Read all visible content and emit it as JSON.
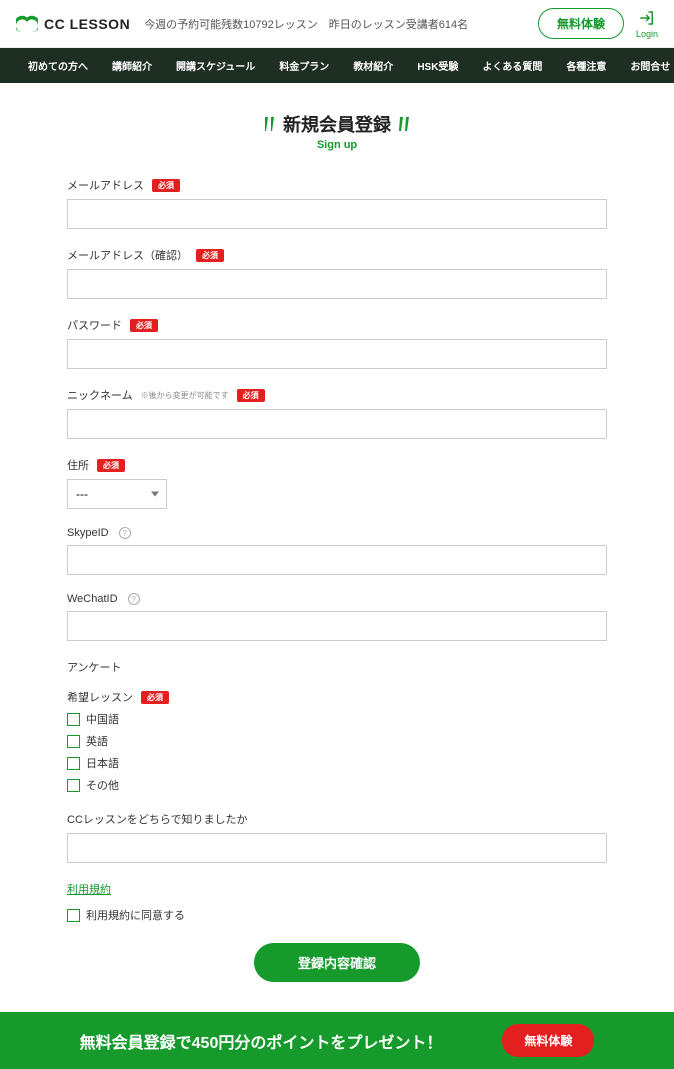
{
  "header": {
    "logo_text": "CC LESSON",
    "info": "今週の予約可能残数10792レッスン　昨日のレッスン受講者614名",
    "trial_label": "無料体験",
    "login_label": "Login"
  },
  "nav": {
    "left": [
      "初めての方へ",
      "講師紹介",
      "開講スケジュール",
      "料金プラン",
      "教材紹介",
      "HSK受験",
      "よくある質問"
    ],
    "right": [
      "各種注意",
      "お問合せ"
    ]
  },
  "page": {
    "title": "新規会員登録",
    "subtitle": "Sign up"
  },
  "fields": {
    "email_label": "メールアドレス",
    "email_confirm_label": "メールアドレス（確認）",
    "password_label": "パスワード",
    "nickname_label": "ニックネーム",
    "nickname_hint": "※後から変更が可能です",
    "address_label": "住所",
    "address_value": "---",
    "skype_label": "SkypeID",
    "wechat_label": "WeChatID",
    "survey_head": "アンケート",
    "desired_label": "希望レッスン",
    "desired_options": {
      "cn": "中国語",
      "en": "英語",
      "jp": "日本語",
      "other": "その他"
    },
    "referral_label": "CCレッスンをどちらで知りましたか"
  },
  "terms": {
    "link_label": "利用規約",
    "agree_label": "利用規約に同意する"
  },
  "badge": {
    "required": "必須"
  },
  "buttons": {
    "submit": "登録内容確認"
  },
  "banner": {
    "text": "無料会員登録で450円分のポイントをプレゼント！",
    "cta": "無料体験"
  }
}
